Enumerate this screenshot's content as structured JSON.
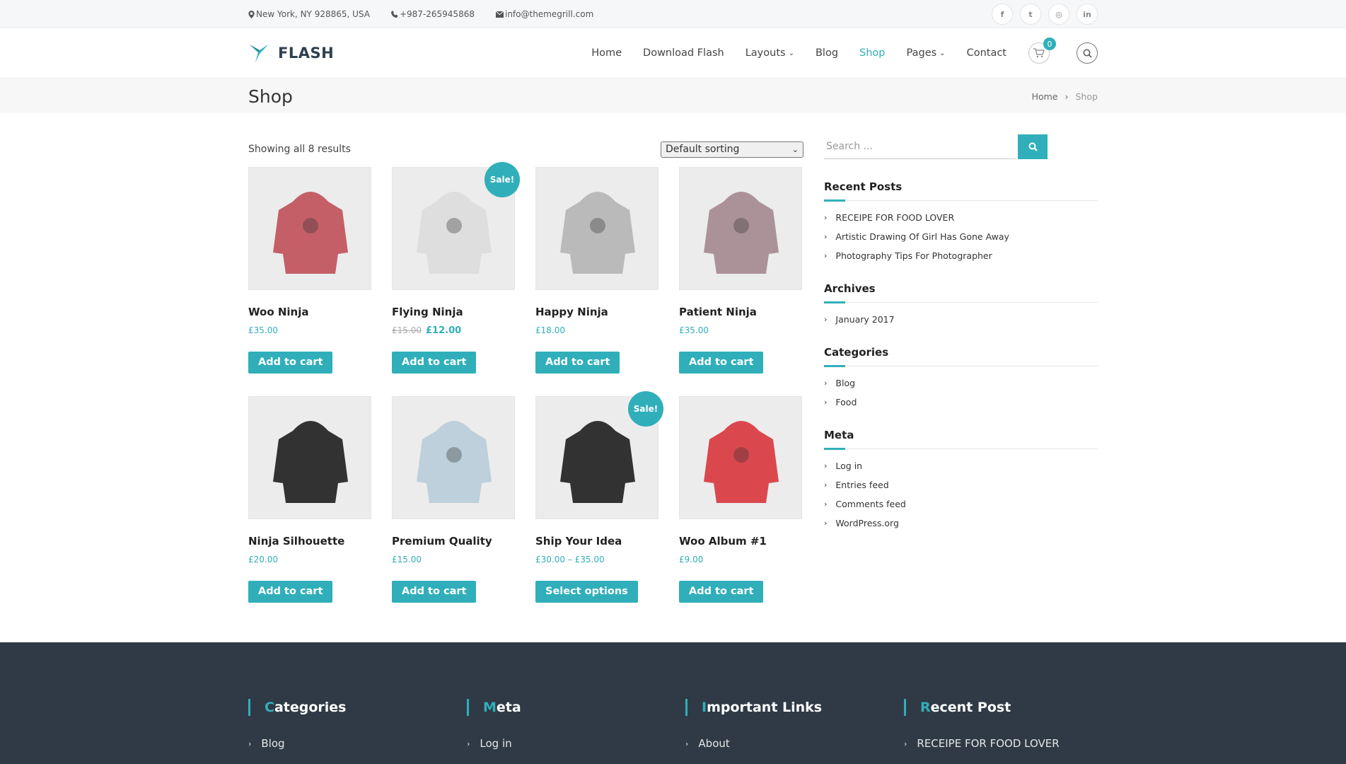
{
  "topbar": {
    "address": "New York, NY 928865, USA",
    "phone": "+987-265945868",
    "email": "info@themegrill.com",
    "social": [
      {
        "icon": "facebook-icon",
        "glyph": "f"
      },
      {
        "icon": "twitter-icon",
        "glyph": "t"
      },
      {
        "icon": "instagram-icon",
        "glyph": "◎"
      },
      {
        "icon": "linkedin-icon",
        "glyph": "in"
      }
    ]
  },
  "header": {
    "logo_text": "FLASH",
    "nav": [
      "Home",
      "Download Flash",
      "Layouts",
      "Blog",
      "Shop",
      "Pages",
      "Contact"
    ],
    "active": "Shop",
    "cart_count": "0"
  },
  "page": {
    "title": "Shop",
    "breadcrumb": [
      "Home",
      "Shop"
    ]
  },
  "shop": {
    "result_count": "Showing all 8 results",
    "ordering": "Default sorting",
    "products": [
      {
        "name": "Woo Ninja",
        "price": "£35.00",
        "old_price": "",
        "sale": false,
        "button": "Add to cart"
      },
      {
        "name": "Flying Ninja",
        "price": "£12.00",
        "old_price": "£15.00",
        "sale": true,
        "button": "Add to cart"
      },
      {
        "name": "Happy Ninja",
        "price": "£18.00",
        "old_price": "",
        "sale": false,
        "button": "Add to cart"
      },
      {
        "name": "Patient Ninja",
        "price": "£35.00",
        "old_price": "",
        "sale": false,
        "button": "Add to cart"
      },
      {
        "name": "Ninja Silhouette",
        "price": "£20.00",
        "old_price": "",
        "sale": false,
        "button": "Add to cart"
      },
      {
        "name": "Premium Quality",
        "price": "£15.00",
        "old_price": "",
        "sale": false,
        "button": "Add to cart"
      },
      {
        "name": "Ship Your Idea",
        "price": "£30.00 – £35.00",
        "old_price": "",
        "sale": true,
        "button": "Select options"
      },
      {
        "name": "Woo Album #1",
        "price": "£9.00",
        "old_price": "",
        "sale": false,
        "button": "Add to cart"
      }
    ],
    "sale_label": "Sale!"
  },
  "sidebar": {
    "search_placeholder": "Search ...",
    "widgets": [
      {
        "title": "Recent Posts",
        "items": [
          "RECEIPE FOR FOOD LOVER",
          "Artistic Drawing Of Girl Has Gone Away",
          "Photography Tips For Photographer"
        ]
      },
      {
        "title": "Archives",
        "items": [
          "January 2017"
        ]
      },
      {
        "title": "Categories",
        "items": [
          "Blog",
          "Food"
        ]
      },
      {
        "title": "Meta",
        "items": [
          "Log in",
          "Entries feed",
          "Comments feed",
          "WordPress.org"
        ]
      }
    ]
  },
  "footer": {
    "columns": [
      {
        "title": "Categories",
        "items": [
          "Blog"
        ]
      },
      {
        "title": "Meta",
        "items": [
          "Log in"
        ]
      },
      {
        "title": "Important Links",
        "items": [
          "About"
        ]
      },
      {
        "title": "Recent Post",
        "items": [
          "RECEIPE FOR FOOD LOVER"
        ]
      }
    ]
  },
  "colors": {
    "accent": "#30afba",
    "footer_bg": "#2f3a46",
    "product_images": [
      "#c0525c",
      "#dcdcdc",
      "#b5b5b5",
      "#a58a90",
      "#222222",
      "#b8cdd9",
      "#222222",
      "#d83a3f"
    ]
  }
}
